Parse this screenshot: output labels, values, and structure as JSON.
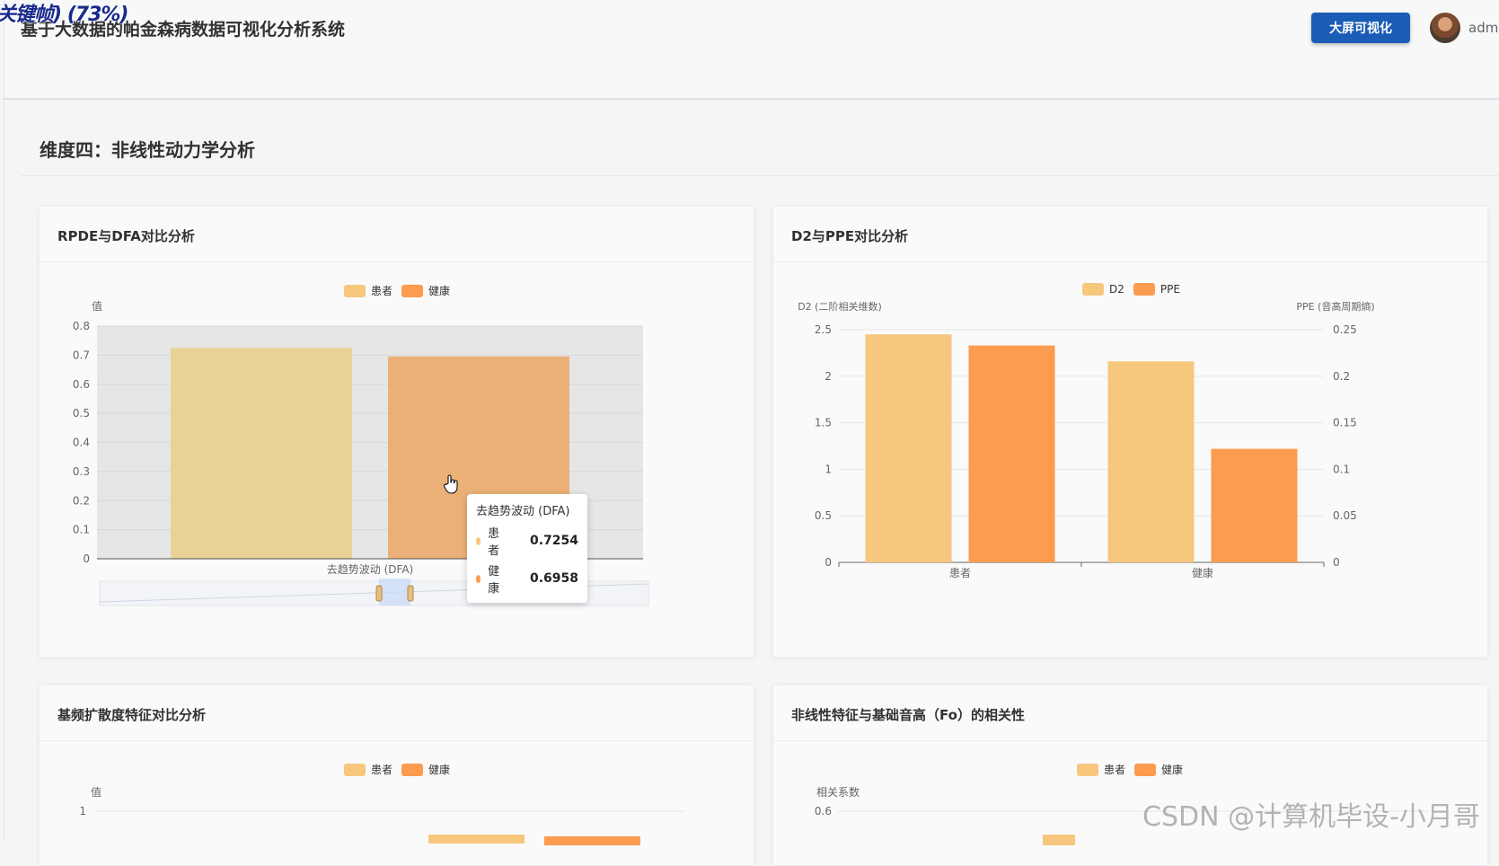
{
  "overlay_text": "关键帧) (73%)",
  "header": {
    "app_title": "基于大数据的帕金森病数据可视化分析系统",
    "bigscreen_button": "大屏可视化",
    "user_name": "admin"
  },
  "section_title": "维度四：非线性动力学分析",
  "cards": {
    "rpde_dfa": {
      "title": "RPDE与DFA对比分析",
      "tooltip": {
        "title": "去趋势波动 (DFA)",
        "rows": [
          {
            "label": "患者",
            "value": "0.7254"
          },
          {
            "label": "健康",
            "value": "0.6958"
          }
        ]
      }
    },
    "d2_ppe": {
      "title": "D2与PPE对比分析"
    },
    "fo_spread": {
      "title": "基频扩散度特征对比分析"
    },
    "nonlinear_fo": {
      "title": "非线性特征与基础音高（Fo）的相关性"
    }
  },
  "colors": {
    "patient": "#f7c77e",
    "healthy": "#fd9b4f",
    "primary": "#1b5cb7"
  },
  "chart_data": [
    {
      "type": "bar",
      "ylabel": "值",
      "categories": [
        "去趋势波动 (DFA)"
      ],
      "series": [
        {
          "name": "患者",
          "values": [
            0.7254
          ]
        },
        {
          "name": "健康",
          "values": [
            0.6958
          ]
        }
      ],
      "ylim": [
        0,
        0.8
      ],
      "yticks": [
        "0",
        "0.1",
        "0.2",
        "0.3",
        "0.4",
        "0.5",
        "0.6",
        "0.7",
        "0.8"
      ],
      "legend": "top-center",
      "highlighted": true,
      "datazoom": true
    },
    {
      "type": "bar",
      "ylabel_left": "D2 (二阶相关维数)",
      "ylabel_right": "PPE (音高周期熵)",
      "categories": [
        "患者",
        "健康"
      ],
      "series": [
        {
          "name": "D2",
          "axis": "left",
          "values": [
            2.45,
            2.16
          ]
        },
        {
          "name": "PPE",
          "axis": "right",
          "values": [
            0.233,
            0.122
          ]
        }
      ],
      "ylim_left": [
        0,
        2.5
      ],
      "ylim_right": [
        0,
        0.25
      ],
      "yticks_left": [
        "0",
        "0.5",
        "1",
        "1.5",
        "2",
        "2.5"
      ],
      "yticks_right": [
        "0",
        "0.05",
        "0.1",
        "0.15",
        "0.2",
        "0.25"
      ],
      "legend": "top-center"
    },
    {
      "type": "bar",
      "ylabel": "值",
      "legend_entries": [
        "患者",
        "健康"
      ],
      "ytick_top": "1",
      "legend": "top-center"
    },
    {
      "type": "bar",
      "ylabel": "相关系数",
      "legend_entries": [
        "患者",
        "健康"
      ],
      "ytick_top": "0.6",
      "legend": "top-center"
    }
  ],
  "watermark": "CSDN @计算机毕设-小月哥"
}
